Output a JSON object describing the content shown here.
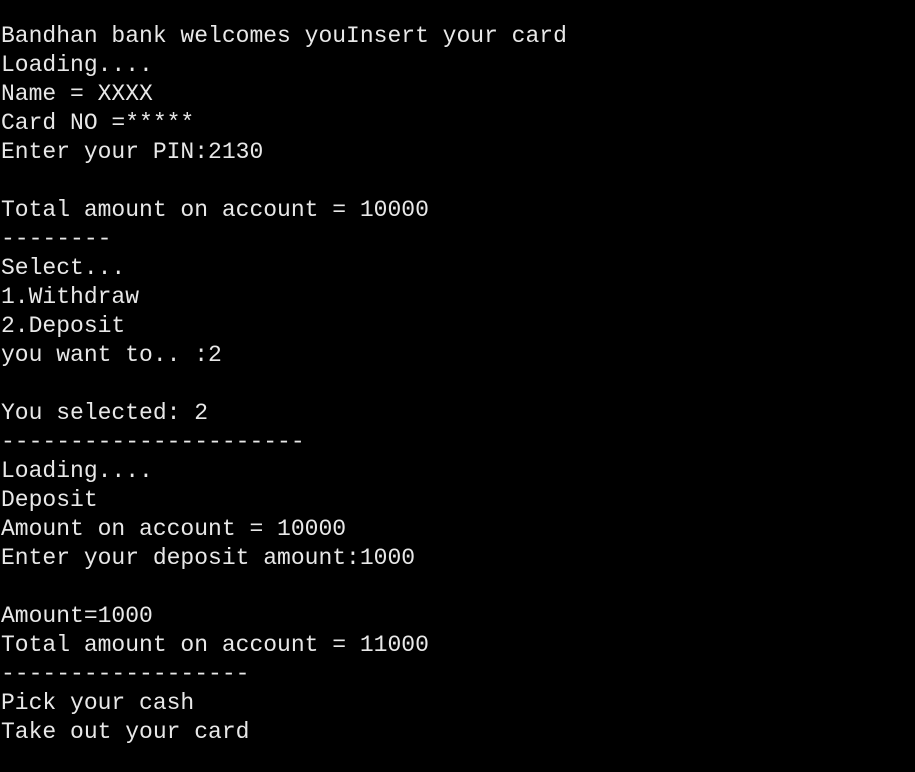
{
  "console": {
    "lines": [
      "Bandhan bank welcomes youInsert your card",
      "Loading....",
      "Name = XXXX",
      "Card NO =*****",
      "Enter your PIN:2130",
      "",
      "Total amount on account = 10000",
      "--------",
      "Select...",
      "1.Withdraw",
      "2.Deposit",
      "you want to.. :2",
      "",
      "You selected: 2",
      "----------------------",
      "Loading....",
      "Deposit",
      "Amount on account = 10000",
      "Enter your deposit amount:1000",
      "",
      "Amount=1000",
      "Total amount on account = 11000",
      "------------------",
      "Pick your cash",
      "Take out your card"
    ]
  }
}
